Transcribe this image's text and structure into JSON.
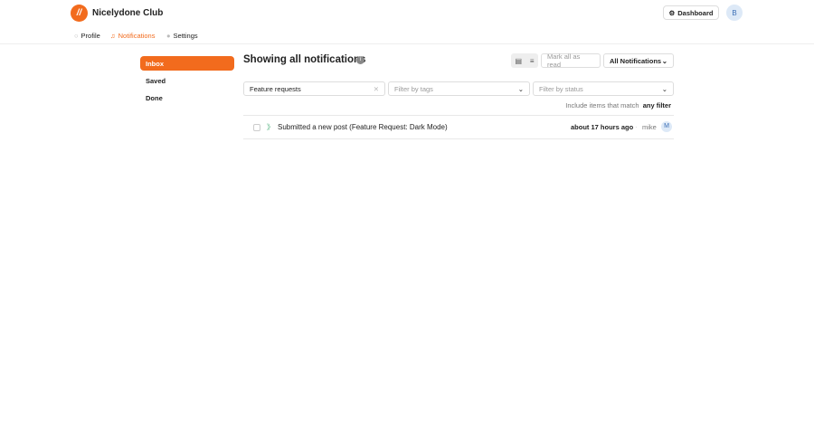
{
  "brand": {
    "name": "Nicelydone Club"
  },
  "header": {
    "dashboard_label": "Dashboard",
    "avatar_initial": "B"
  },
  "nav": {
    "profile": "Profile",
    "notifications": "Notifications",
    "settings": "Settings"
  },
  "sidebar": {
    "items": [
      {
        "label": "Inbox"
      },
      {
        "label": "Saved"
      },
      {
        "label": "Done"
      }
    ]
  },
  "main": {
    "title": "Showing all notifications",
    "mark_all_read": "Mark all as read",
    "filter_select": "All Notifications",
    "search_value": "Feature requests",
    "tags_placeholder": "Filter by tags",
    "status_placeholder": "Filter by status",
    "match_prefix": "Include items that match",
    "match_value": "any filter",
    "notifications": [
      {
        "text": "Submitted a new post (Feature Request: Dark Mode)",
        "time": "about 17 hours ago",
        "user": "mike",
        "user_initial": "M"
      }
    ]
  },
  "colors": {
    "accent": "#f26b1d"
  }
}
